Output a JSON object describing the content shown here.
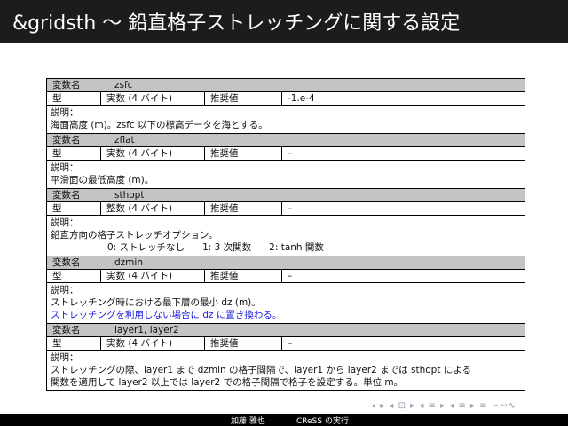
{
  "header": {
    "title": "&gridsth 〜 鉛直格子ストレッチングに関する設定"
  },
  "labels": {
    "var": "変数名",
    "type": "型",
    "rec": "推奨値",
    "desc": "説明："
  },
  "vars": [
    {
      "name": "zsfc",
      "type": "実数 (4 バイト)",
      "rec": "-1.e-4",
      "lines": [
        "海面高度 (m)。zsfc 以下の標高データを海とする。"
      ]
    },
    {
      "name": "zflat",
      "type": "実数 (4 バイト)",
      "rec": "–",
      "lines": [
        "平滑面の最低高度 (m)。"
      ]
    },
    {
      "name": "sthopt",
      "type": "整数 (4 バイト)",
      "rec": "–",
      "lines": [
        "鉛直方向の格子ストレッチオプション。"
      ],
      "options": [
        "0: ストレッチなし",
        "1: 3 次関数",
        "2: tanh 関数"
      ]
    },
    {
      "name": "dzmin",
      "type": "実数 (4 バイト)",
      "rec": "–",
      "lines": [
        "ストレッチング時における最下層の最小 dz (m)。"
      ],
      "blue": "ストレッチングを利用しない場合に dz に置き換わる。"
    },
    {
      "name": "layer1, layer2",
      "type": "実数 (4 バイト)",
      "rec": "–",
      "lines": [
        "ストレッチングの際、layer1 まで dzmin の格子間隔で、layer1 から layer2 までは sthopt による",
        "関数を適用して layer2 以上では layer2 での格子間隔で格子を設定する。単位 m。"
      ]
    }
  ],
  "footer": {
    "author": "加藤 雅也",
    "institution": "CReSS の実行"
  },
  "nav": {
    "symbols": "◂ ▸ ◂ ⊡ ▸ ◂ ≡ ▸ ◂ ≡ ▸  ≡  ∽∾∿"
  }
}
